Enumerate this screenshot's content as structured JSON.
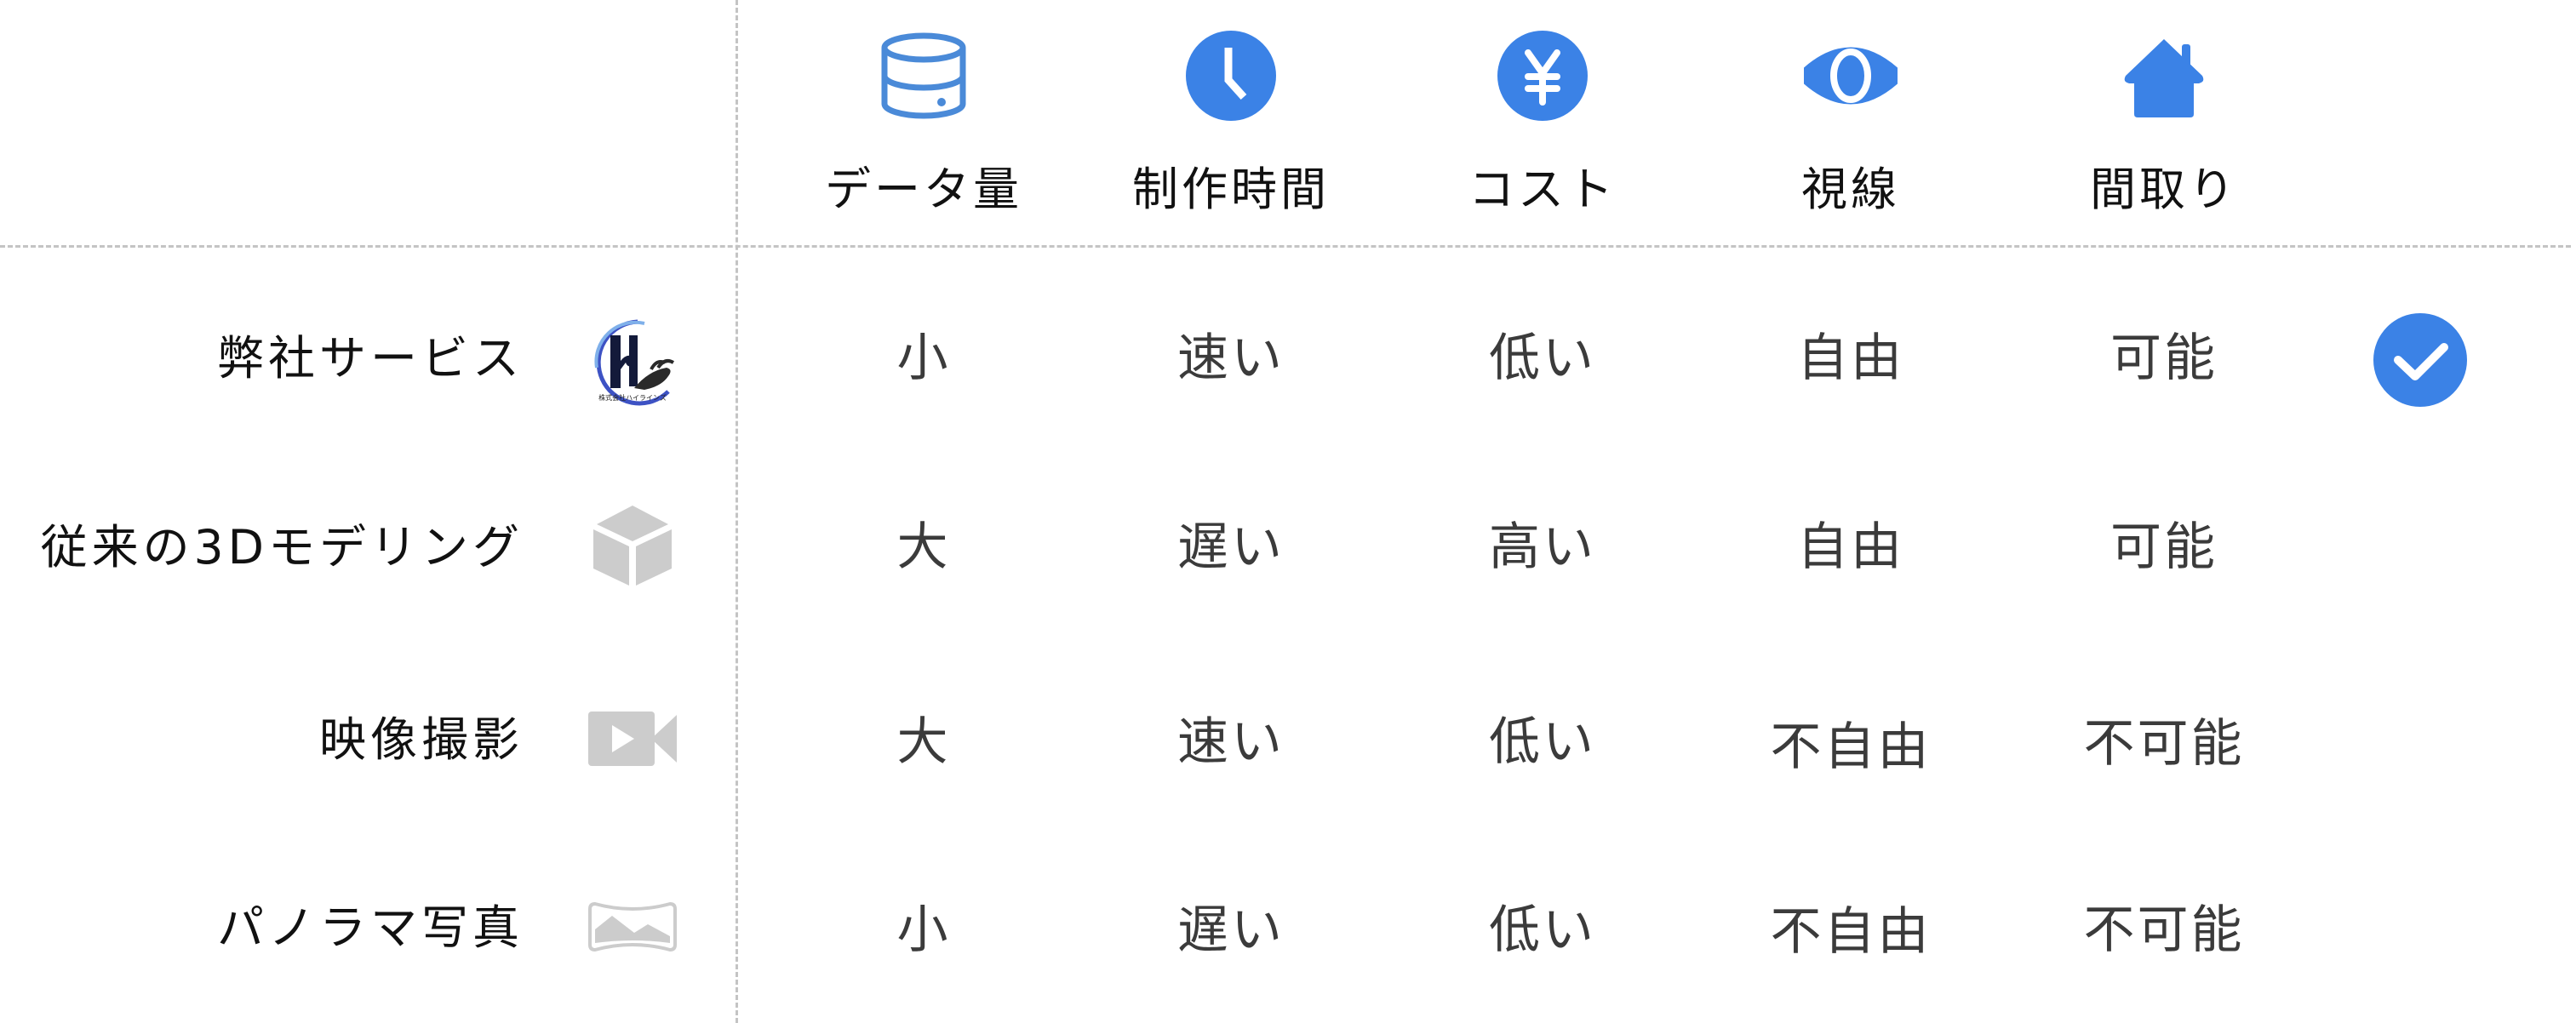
{
  "colors": {
    "accent": "#3b82e6",
    "icon_gray": "#cccccc",
    "divider": "#c4c4c4",
    "header_text": "#111111",
    "cell_text": "#3b3b3b"
  },
  "columns": [
    {
      "label": "データ量",
      "icon": "database-icon"
    },
    {
      "label": "制作時間",
      "icon": "clock-icon"
    },
    {
      "label": "コスト",
      "icon": "yen-coin-icon"
    },
    {
      "label": "視線",
      "icon": "eye-icon"
    },
    {
      "label": "間取り",
      "icon": "house-icon"
    }
  ],
  "rows": [
    {
      "label": "弊社サービス",
      "icon": "company-logo",
      "logo_text": "株式会社ハイラインズ",
      "values": [
        "小",
        "速い",
        "低い",
        "自由",
        "可能"
      ],
      "recommended": true
    },
    {
      "label": "従来の3Dモデリング",
      "icon": "cube-icon",
      "values": [
        "大",
        "遅い",
        "高い",
        "自由",
        "可能"
      ],
      "recommended": false
    },
    {
      "label": "映像撮影",
      "icon": "video-camera-icon",
      "values": [
        "大",
        "速い",
        "低い",
        "不自由",
        "不可能"
      ],
      "recommended": false
    },
    {
      "label": "パノラマ写真",
      "icon": "panorama-icon",
      "values": [
        "小",
        "遅い",
        "低い",
        "不自由",
        "不可能"
      ],
      "recommended": false
    }
  ],
  "recommended_marker": {
    "icon": "check-circle-icon"
  }
}
